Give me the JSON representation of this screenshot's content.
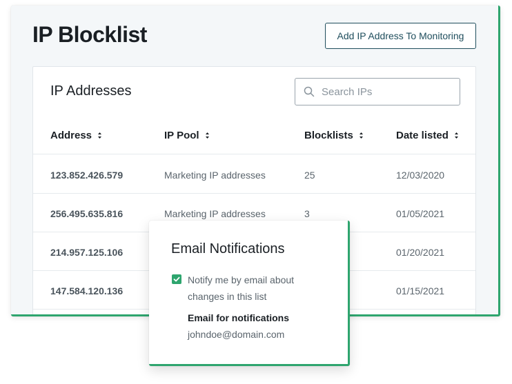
{
  "page": {
    "title": "IP Blocklist",
    "add_button_label": "Add IP Address To Monitoring"
  },
  "table_card": {
    "title": "IP Addresses",
    "search_placeholder": "Search IPs",
    "columns": [
      "Address",
      "IP Pool",
      "Blocklists",
      "Date listed"
    ],
    "rows": [
      {
        "address": "123.852.426.579",
        "pool": "Marketing IP addresses",
        "blocklists": "25",
        "date": "12/03/2020"
      },
      {
        "address": "256.495.635.816",
        "pool": "Marketing IP addresses",
        "blocklists": "3",
        "date": "01/05/2021"
      },
      {
        "address": "214.957.125.106",
        "pool": "",
        "blocklists": "",
        "date": "01/20/2021"
      },
      {
        "address": "147.584.120.136",
        "pool": "",
        "blocklists": "",
        "date": "01/15/2021"
      }
    ]
  },
  "notifications": {
    "title": "Email Notifications",
    "checkbox_label": "Notify me by email about changes in this list",
    "checkbox_checked": true,
    "email_label": "Email for notifications",
    "email_value": "johndoe@domain.com"
  },
  "colors": {
    "accent_green": "#2ea56e",
    "button_border": "#1e4d5c",
    "panel_bg": "#f4f7f9"
  },
  "icons": {
    "search": "search-icon",
    "sort": "sort-icon",
    "check": "check-icon"
  }
}
